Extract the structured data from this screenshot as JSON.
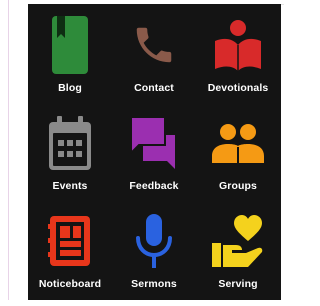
{
  "menu": {
    "items": [
      {
        "label": "Blog",
        "icon": "bookmark-book-icon",
        "color": "#2e8b3a"
      },
      {
        "label": "Contact",
        "icon": "phone-icon",
        "color": "#8a5a4a"
      },
      {
        "label": "Devotionals",
        "icon": "reading-person-icon",
        "color": "#d82a2a"
      },
      {
        "label": "Events",
        "icon": "calendar-icon",
        "color": "#8a8a8a"
      },
      {
        "label": "Feedback",
        "icon": "chat-bubbles-icon",
        "color": "#9b2fb0"
      },
      {
        "label": "Groups",
        "icon": "people-group-icon",
        "color": "#f59a14"
      },
      {
        "label": "Noticeboard",
        "icon": "notebook-icon",
        "color": "#e8361b"
      },
      {
        "label": "Sermons",
        "icon": "microphone-icon",
        "color": "#2a62e0"
      },
      {
        "label": "Serving",
        "icon": "hand-heart-icon",
        "color": "#f4d21d"
      }
    ]
  }
}
